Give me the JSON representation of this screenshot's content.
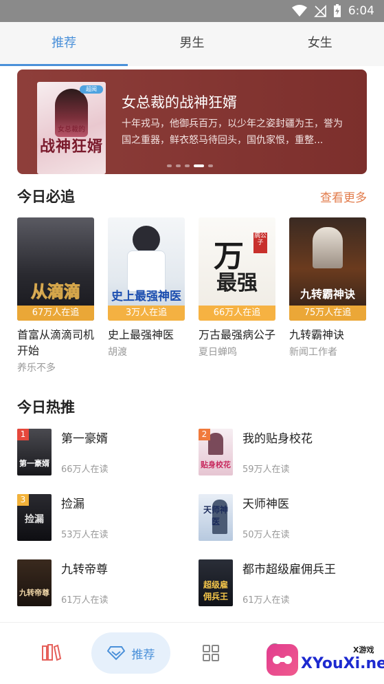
{
  "status_bar": {
    "time": "6:04",
    "icons": [
      "wifi-icon",
      "signal-off-icon",
      "battery-charging-icon"
    ]
  },
  "tabs": [
    {
      "label": "推荐",
      "active": true
    },
    {
      "label": "男生",
      "active": false
    },
    {
      "label": "女生",
      "active": false
    }
  ],
  "banner": {
    "title": "女总裁的战神狂婿",
    "description": "十年戎马，他御兵百万，以少年之姿封疆为王，誉为国之重器，鲜衣怒马待回头，国仇家恨，重整...",
    "cover_title": "战神狂婿",
    "cover_subtitle": "女总裁的",
    "cover_tag": "超阅",
    "page_count": 5,
    "active_page": 4
  },
  "must_follow": {
    "title": "今日必追",
    "more": "查看更多",
    "books": [
      {
        "title": "首富从滴滴司机开始",
        "author": "养乐不多",
        "readers": "67万人在追",
        "cover_text": "从滴滴"
      },
      {
        "title": "史上最强神医",
        "author": "胡渡",
        "readers": "3万人在追",
        "cover_text": "史上最强神医"
      },
      {
        "title": "万古最强病公子",
        "author": "夏日蝉鸣",
        "readers": "66万人在追",
        "cover_text": "最强"
      },
      {
        "title": "九转霸神诀",
        "author": "新闻工作者",
        "readers": "75万人在追",
        "cover_text": "九转霸神诀"
      }
    ]
  },
  "hot_today": {
    "title": "今日热推",
    "items": [
      {
        "rank": "1",
        "title": "第一豪婿",
        "reads": "66万人在读",
        "cover_text": "第一豪婿"
      },
      {
        "rank": "2",
        "title": "我的贴身校花",
        "reads": "59万人在读",
        "cover_text": "贴身校花"
      },
      {
        "rank": "3",
        "title": "捡漏",
        "reads": "53万人在读",
        "cover_text": "捡漏"
      },
      {
        "rank": "",
        "title": "天师神医",
        "reads": "50万人在读",
        "cover_text": "天师神医"
      },
      {
        "rank": "",
        "title": "九转帝尊",
        "reads": "61万人在读",
        "cover_text": "九转帝尊"
      },
      {
        "rank": "",
        "title": "都市超级雇佣兵王",
        "reads": "61万人在读",
        "cover_text": "超级雇佣兵王"
      }
    ]
  },
  "bottom_nav": {
    "items": [
      {
        "icon": "bookshelf-icon"
      },
      {
        "icon": "diamond-icon",
        "label": "推荐",
        "active": true
      },
      {
        "icon": "grid-icon"
      },
      {
        "icon": "profile-icon"
      }
    ]
  },
  "watermark": {
    "text": "XYouXi.net",
    "small": "X游戏"
  },
  "colors": {
    "accent": "#4a90d9",
    "badge": "#f6af39",
    "more": "#e27c4c",
    "banner": "#8e3e3a"
  }
}
